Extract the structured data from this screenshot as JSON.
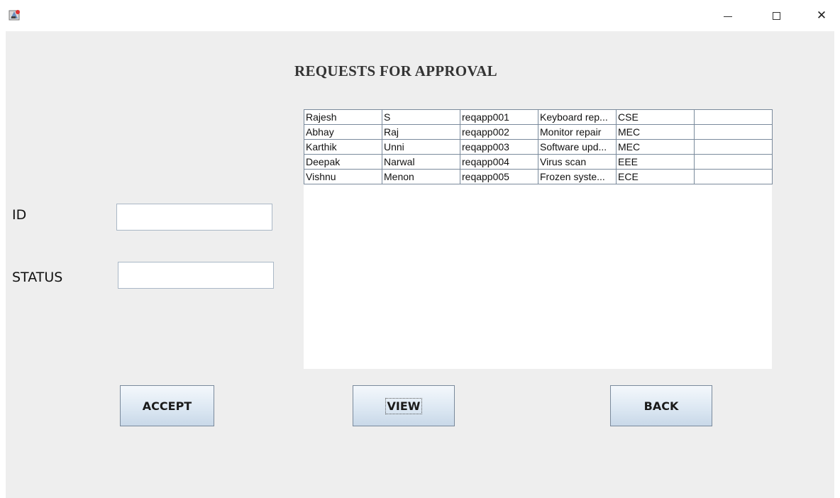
{
  "window": {
    "minimize_icon": "minimize-icon",
    "maximize_icon": "maximize-icon",
    "close_glyph": "✕"
  },
  "page": {
    "heading": "REQUESTS FOR APPROVAL"
  },
  "form": {
    "id_label": "ID",
    "id_value": "",
    "status_label": "STATUS",
    "status_value": ""
  },
  "table": {
    "rows": [
      [
        "Rajesh",
        "S",
        "reqapp001",
        "Keyboard rep...",
        "CSE",
        ""
      ],
      [
        "Abhay",
        "Raj",
        "reqapp002",
        "Monitor repair",
        "MEC",
        ""
      ],
      [
        "Karthik",
        "Unni",
        "reqapp003",
        "Software upd...",
        "MEC",
        ""
      ],
      [
        "Deepak",
        "Narwal",
        "reqapp004",
        "Virus scan",
        "EEE",
        ""
      ],
      [
        "Vishnu",
        "Menon",
        "reqapp005",
        "Frozen syste...",
        "ECE",
        ""
      ]
    ]
  },
  "buttons": {
    "accept": "ACCEPT",
    "view": "VIEW",
    "back": "BACK"
  }
}
